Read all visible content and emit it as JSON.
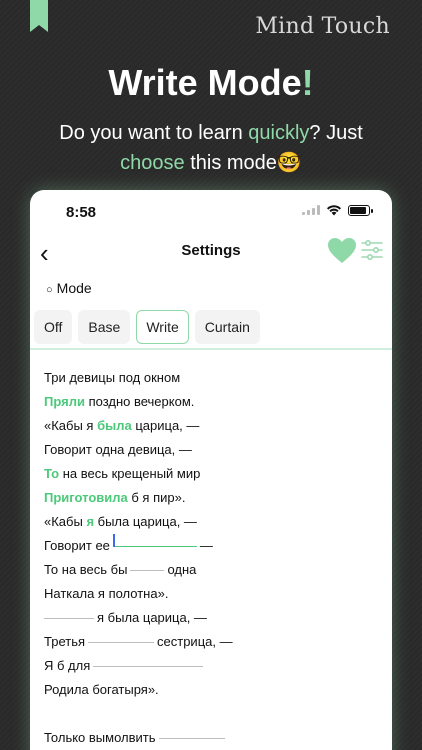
{
  "brand": "Mind Touch",
  "headline": {
    "text": "Write Mode",
    "accent": "!"
  },
  "subline": {
    "part1": "Do you want to learn ",
    "quickly": "quickly",
    "part2": "? Just",
    "choose": "choose",
    "part3": " this mode",
    "emoji": "🤓"
  },
  "phone": {
    "status_time": "8:58",
    "nav_title": "Settings",
    "back_glyph": "‹",
    "mode_label": "Mode",
    "mode_bullet": "○",
    "modes": [
      {
        "label": "Off",
        "active": false
      },
      {
        "label": "Base",
        "active": false
      },
      {
        "label": "Write",
        "active": true
      },
      {
        "label": "Curtain",
        "active": false
      }
    ]
  },
  "poem": {
    "l1": "Три девицы под окном",
    "l2_hl": "Пряли",
    "l2": " поздно вечерком.",
    "l3_a": "«Кабы я ",
    "l3_hl": "была",
    "l3_b": " царица, —",
    "l4": "Говорит одна девица, —",
    "l5_hl": "То",
    "l5": " на весь крещеный мир",
    "l6_hl": "Приготовила",
    "l6": " б я пир».",
    "l7_a": "«Кабы ",
    "l7_hl": "я",
    "l7_b": " была царица, —",
    "l8_a": "Говорит ее",
    "l8_b": "—",
    "l9_a": "То на весь бы",
    "l9_b": "одна",
    "l10": "Наткала я полотна».",
    "l11": "я была царица, —",
    "l12_a": "Третья",
    "l12_b": "сестрица, —",
    "l13": "Я б для",
    "l14": "Родила богатыря».",
    "l16": "Только вымолвить"
  }
}
